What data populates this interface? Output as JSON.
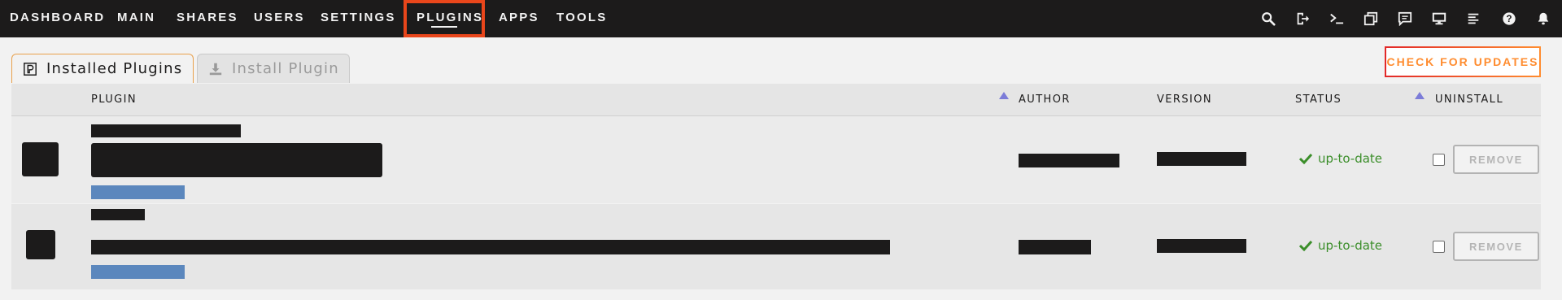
{
  "nav": {
    "items": [
      {
        "id": "dashboard",
        "label": "DASHBOARD"
      },
      {
        "id": "main",
        "label": "MAIN"
      },
      {
        "id": "shares",
        "label": "SHARES"
      },
      {
        "id": "users",
        "label": "USERS"
      },
      {
        "id": "settings",
        "label": "SETTINGS"
      },
      {
        "id": "plugins",
        "label": "PLUGINS",
        "active": true
      },
      {
        "id": "apps",
        "label": "APPS"
      },
      {
        "id": "tools",
        "label": "TOOLS"
      }
    ],
    "icons": [
      "search-icon",
      "logout-icon",
      "terminal-icon",
      "windows-icon",
      "feedback-icon",
      "monitor-icon",
      "log-icon",
      "help-icon",
      "bell-icon"
    ]
  },
  "tabs": {
    "installed": "Installed Plugins",
    "install": "Install Plugin"
  },
  "actions": {
    "check_updates": "CHECK FOR UPDATES"
  },
  "table": {
    "headers": {
      "plugin": "PLUGIN",
      "author": "AUTHOR",
      "version": "VERSION",
      "status": "STATUS",
      "uninstall": "UNINSTALL"
    },
    "rows": [
      {
        "status": "up-to-date",
        "remove_label": "REMOVE",
        "checked": false
      },
      {
        "status": "up-to-date",
        "remove_label": "REMOVE",
        "checked": false
      }
    ]
  },
  "colors": {
    "topbar": "#1c1b1b",
    "active_outline": "#e9461b",
    "accent_orange": "#ff8c2f",
    "status_green": "#3b8e2a",
    "link_blue": "#5b87bd",
    "sort_arrow": "#7c7cd8"
  }
}
